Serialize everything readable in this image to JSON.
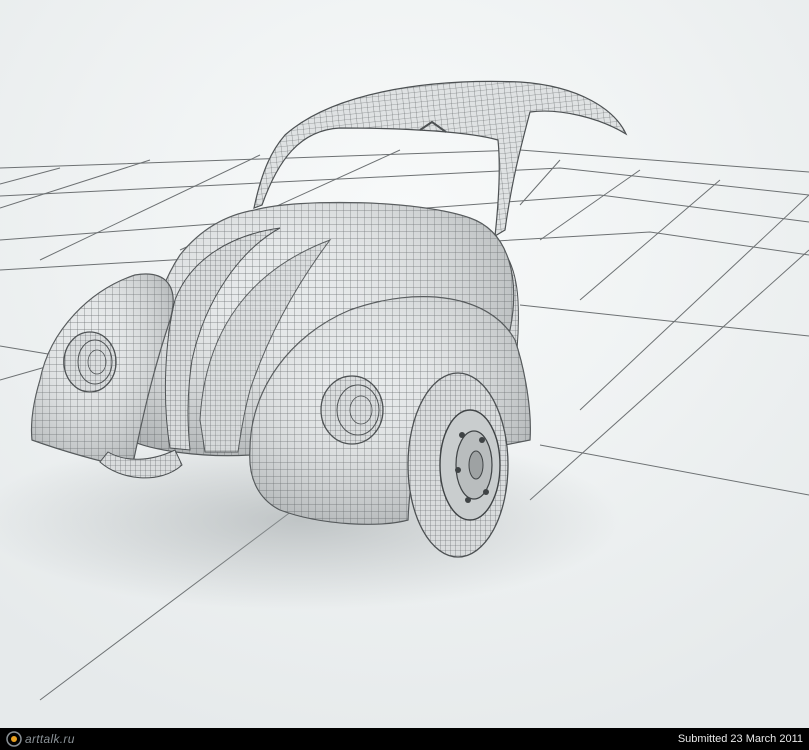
{
  "footer": {
    "logo_label": "arttalk.ru",
    "submitted_text": "Submitted 23 March 2011"
  },
  "colors": {
    "background": "#eef1f2",
    "grid_line": "#6d7173",
    "mesh_fill": "#e3e6e7",
    "mesh_line": "#5b5f61",
    "footer_bg": "#000000",
    "logo_accent": "#e8a020"
  },
  "icons": {
    "logo": "arttalk-logo-icon"
  }
}
